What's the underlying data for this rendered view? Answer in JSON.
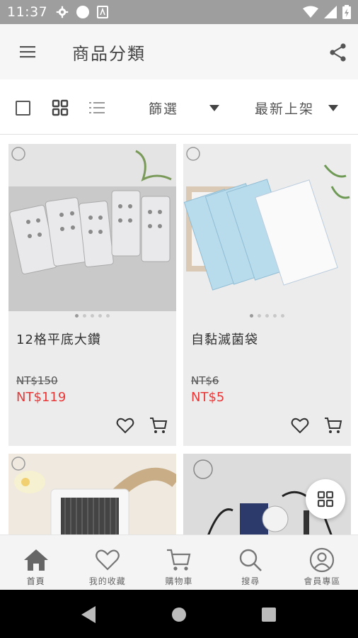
{
  "status_bar": {
    "time": "11:37"
  },
  "header": {
    "title": "商品分類"
  },
  "toolbar": {
    "filter_label": "篩選",
    "sort_label": "最新上架"
  },
  "products": [
    {
      "name": "12格平底大鑽",
      "old_price": "NT$150",
      "price": "NT$119",
      "image_icon": "nail-rhinestone-case-image",
      "dots": 5,
      "active_dot": 0
    },
    {
      "name": "自黏滅菌袋",
      "old_price": "NT$6",
      "price": "NT$5",
      "image_icon": "sterilization-pouch-image",
      "dots": 5,
      "active_dot": 0
    },
    {
      "name": "",
      "old_price": "",
      "price": "",
      "image_icon": "nail-dust-collector-image"
    },
    {
      "name": "",
      "old_price": "",
      "price": "",
      "image_icon": "nail-drill-device-image"
    }
  ],
  "bottom_nav": [
    {
      "label": "首頁",
      "icon": "home-icon",
      "active": true
    },
    {
      "label": "我的收藏",
      "icon": "heart-icon",
      "active": false
    },
    {
      "label": "購物車",
      "icon": "cart-icon",
      "active": false
    },
    {
      "label": "搜尋",
      "icon": "search-icon",
      "active": false
    },
    {
      "label": "會員專區",
      "icon": "user-icon",
      "active": false
    }
  ],
  "colors": {
    "sale_price": "#e83838",
    "status_bar": "#9e9e9e",
    "app_bar": "#f6f6f6",
    "card_bg": "#ececec"
  }
}
